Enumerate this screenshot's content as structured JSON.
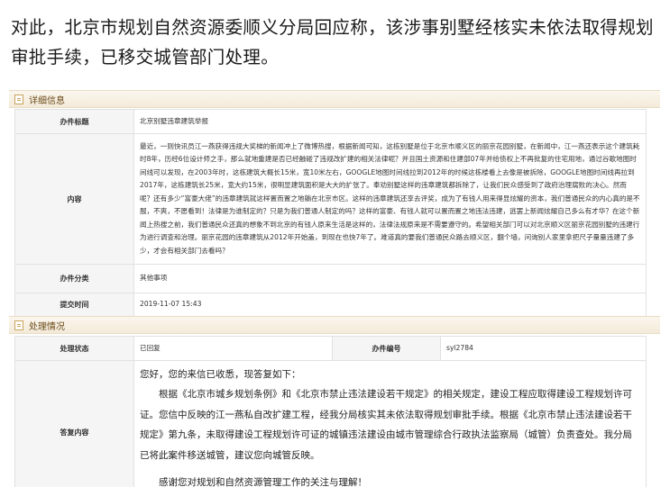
{
  "headline": "对此，北京市规划自然资源委顺义分局回应称，该涉事别墅经核实未依法取得规划审批手续，已移交城管部门处理。",
  "details_section": {
    "title": "详细信息",
    "rows": {
      "subject": {
        "label": "办件标题",
        "value": "北京别墅违章建筑举报"
      },
      "content": {
        "label": "内容",
        "value": "最近，一则快讯员江一燕获得违规大奖梯的新闻冲上了微博热搜，根据新闻可知，这栋别墅是位于北京市顺义区的丽京花园别墅，在新闻中，江一燕还表示这个建筑耗时8年，历经6位设计师之手，那么就地重建是否已经触碰了违规改扩建的相关法律呢？并且国土资源和住建部07年并给债权上不再批复的住宅用地，通过谷歌地图时间线可以发现，在2003年时，这栋建筑大概长15米，宽10米左右，GOOGLE地图时间线拉到2012年的时候这栋楼看上去像是被拆除，GOOGLE地图时间线再拉到2017年，这栋建筑长25米，宽大约15米，很明显建筑面积是大大的扩张了。奉劝别墅这样的违章建筑都拆除了，让我们民众感受到了政府治理腐败的决心。然而呢？还有多少“富豪大佬”的违章建筑就这样置而置之地躺在北京市区。这样的违章建筑还享去评奖，成为了有钱人用来得显炫耀的资本，我们普通民众的内心真的是不服，不爽，不愿看到！法律是为谁制定的？只是为我们普通人制定的吗？这样的富豪、有钱人就可以置而置之地违法违建，逃罢上新闻炫耀自己多么有才华？在这个新闻上热搜之前，我们普通民众还真的想象不到北京的有钱人原来生活是这样的，法律法规原来是不需要遵守的。希望相关部门可以对北京顺义区丽京花园别墅的违建行为进行调查和治理。丽京花园的违章建筑从2012年开始盖，到现在也快7年了。难道真的要我们普通民众路去顺义区，翻个墙，问询别人家里拿把尺子量量违建了多少，才会有相关部门去看吗？"
      },
      "category": {
        "label": "办件分类",
        "value": "其他事项"
      },
      "submit_time": {
        "label": "提交时间",
        "value": "2019-11-07 15:43"
      }
    }
  },
  "handling_section": {
    "title": "处理情况",
    "status_label": "处理状态",
    "status_value": "已回复",
    "case_no_label": "办件编号",
    "case_no_value": "syl2784",
    "reply_label": "答复内容",
    "reply": {
      "greeting": "您好，您的来信已收悉，现答复如下：",
      "body": "根据《北京市城乡规划条例》和《北京市禁止违法建设若干规定》的相关规定，建设工程应取得建设工程规划许可证。您信中反映的江一燕私自改扩建工程，经我分局核实其未依法取得规划审批手续。根据《北京市禁止违法建设若干规定》第九条，未取得建设工程规划许可证的城镇违法建设由城市管理综合行政执法监察局（城管）负责查处。我分局已将此案件移送城管，建议您向城管反映。",
      "closing": "感谢您对规划和自然资源管理工作的关注与理解！"
    }
  },
  "colors": {
    "section_bar": "#f3ead9",
    "section_text": "#6a4b1a",
    "label_bg": "#f5f5f5",
    "border": "#e1e1e1"
  }
}
